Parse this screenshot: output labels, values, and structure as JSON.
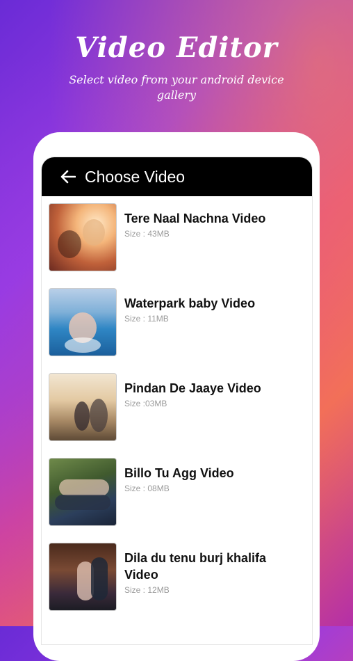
{
  "header": {
    "title": "Video Editor",
    "subtitle": "Select video from your android device gallery"
  },
  "appbar": {
    "title": "Choose Video",
    "back_icon": "arrow-left-icon"
  },
  "videos": [
    {
      "name": "Tere Naal Nachna Video",
      "size": "Size : 43MB"
    },
    {
      "name": "Waterpark baby Video",
      "size": "Size : 11MB"
    },
    {
      "name": "Pindan De Jaaye Video",
      "size": "Size :03MB"
    },
    {
      "name": "Billo Tu Agg Video",
      "size": "Size : 08MB"
    },
    {
      "name": "Dila du tenu burj khalifa Video",
      "size": "Size : 12MB"
    }
  ]
}
